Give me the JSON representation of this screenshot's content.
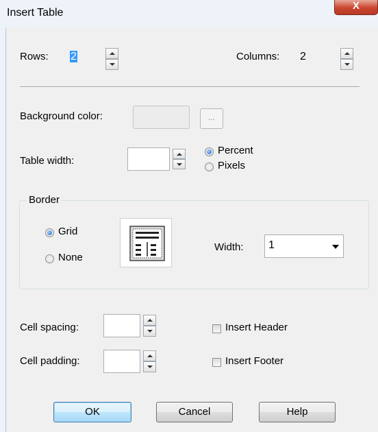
{
  "window": {
    "title": "Insert Table",
    "close_glyph": "X"
  },
  "rows": {
    "label": "Rows:",
    "value": "2"
  },
  "columns": {
    "label": "Columns:",
    "value": "2"
  },
  "background": {
    "label": "Background color:",
    "browse_label": "..."
  },
  "table_width": {
    "label": "Table width:",
    "value": "",
    "unit_options": [
      "Percent",
      "Pixels"
    ],
    "selected_unit": "Percent"
  },
  "border": {
    "group_label": "Border",
    "options": [
      "Grid",
      "None"
    ],
    "selected": "Grid",
    "preview_icon": "table-grid-preview-icon",
    "width_label": "Width:",
    "width_value": "1"
  },
  "cell_spacing": {
    "label": "Cell spacing:",
    "value": ""
  },
  "cell_padding": {
    "label": "Cell padding:",
    "value": ""
  },
  "insert_header": {
    "label": "Insert Header",
    "checked": false
  },
  "insert_footer": {
    "label": "Insert Footer",
    "checked": false
  },
  "buttons": {
    "ok": "OK",
    "cancel": "Cancel",
    "help": "Help"
  }
}
